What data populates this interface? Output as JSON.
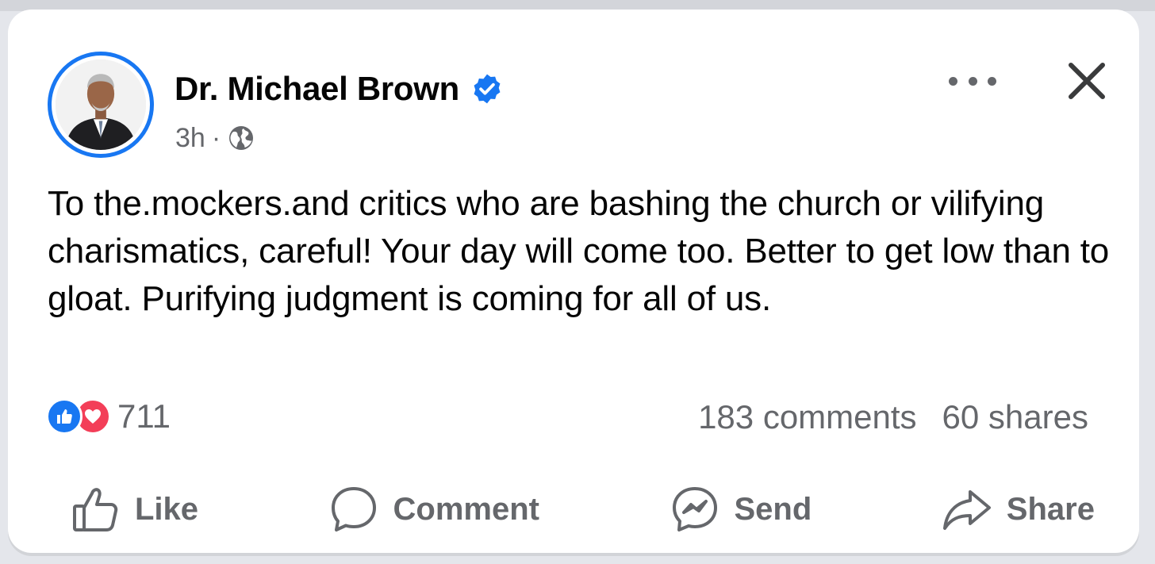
{
  "post": {
    "author": "Dr. Michael Brown",
    "timestamp": "3h",
    "separator": "·",
    "audience_icon": "globe-icon",
    "verified_icon": "verified-badge-icon",
    "text": "To the.mockers.and critics who are bashing the church or vilifying charismatics, careful! Your day will come too. Better to get low than to gloat. Purifying judgment is coming for all of us."
  },
  "header_actions": {
    "more_icon": "more-options-icon",
    "close_icon": "close-icon"
  },
  "reactions": {
    "types": [
      "like",
      "love"
    ],
    "count": "711"
  },
  "stats": {
    "comments": "183 comments",
    "shares": "60 shares"
  },
  "actions": [
    {
      "label": "Like",
      "icon": "thumbs-up-icon"
    },
    {
      "label": "Comment",
      "icon": "comment-bubble-icon"
    },
    {
      "label": "Send",
      "icon": "messenger-icon"
    },
    {
      "label": "Share",
      "icon": "share-arrow-icon"
    }
  ],
  "colors": {
    "accent": "#1877f2",
    "love": "#f33e58",
    "secondary_text": "#65676b",
    "primary_text": "#050505",
    "background": "#e4e6eb"
  }
}
